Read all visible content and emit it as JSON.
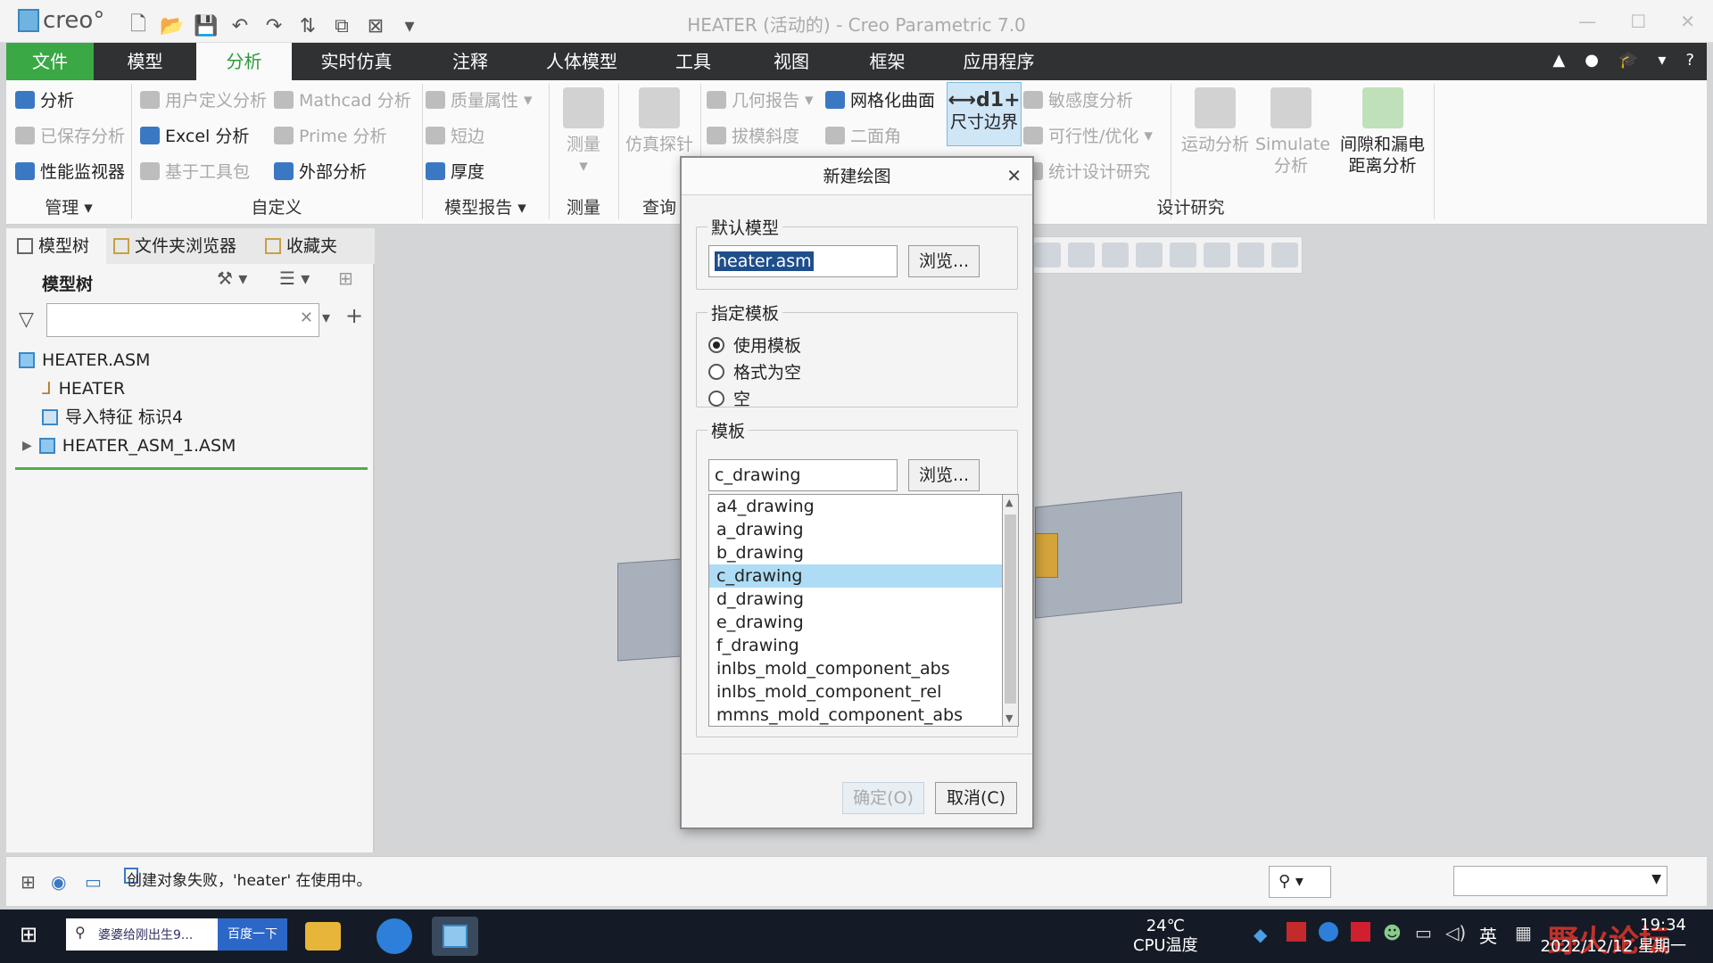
{
  "window": {
    "title": "HEATER (活动的) - Creo Parametric 7.0",
    "logo": "creo°",
    "controls": [
      "—",
      "☐",
      "✕"
    ]
  },
  "ribbon": {
    "tabs": [
      "文件",
      "模型",
      "分析",
      "实时仿真",
      "注释",
      "人体模型",
      "工具",
      "视图",
      "框架",
      "应用程序"
    ],
    "active_tab": "分析",
    "manage": {
      "items": [
        "分析",
        "已保存分析",
        "性能监视器"
      ],
      "group": "管理 ▾"
    },
    "custom": {
      "items": [
        "用户定义分析",
        "Excel 分析",
        "基于工具包",
        "Mathcad 分析",
        "Prime 分析",
        "外部分析"
      ],
      "group": "自定义"
    },
    "report": {
      "items": [
        "质量属性",
        "短边",
        "厚度"
      ],
      "group": "模型报告 ▾"
    },
    "measure": {
      "label": "测量",
      "group": "测量"
    },
    "query": {
      "label": "仿真探针",
      "group": "查询"
    },
    "inspect": {
      "items": [
        "几何报告",
        "拔模斜度",
        "网格化曲面",
        "二面角"
      ],
      "dim": "尺寸边界"
    },
    "design": {
      "items": [
        "敏感度分析",
        "可行性/优化",
        "统计设计研究"
      ],
      "big": [
        "运动分析",
        "Simulate 分析",
        "间隙和漏电 距离分析"
      ],
      "group": "设计研究"
    }
  },
  "left_panel": {
    "tabs": [
      "模型树",
      "文件夹浏览器",
      "收藏夹"
    ],
    "tree_label": "模型树",
    "filter_placeholder": "",
    "tree": [
      "HEATER.ASM",
      "HEATER",
      "导入特征 标识4",
      "HEATER_ASM_1.ASM"
    ]
  },
  "dialog": {
    "title": "新建绘图",
    "default_model_label": "默认模型",
    "default_model_value": "heater.asm",
    "browse": "浏览...",
    "template_spec_label": "指定模板",
    "options": [
      "使用模板",
      "格式为空",
      "空"
    ],
    "selected_option": 0,
    "template_label": "模板",
    "template_value": "c_drawing",
    "templates": [
      "a4_drawing",
      "a_drawing",
      "b_drawing",
      "c_drawing",
      "d_drawing",
      "e_drawing",
      "f_drawing",
      "inlbs_mold_component_abs",
      "inlbs_mold_component_rel",
      "mmns_mold_component_abs"
    ],
    "selected_template": "c_drawing",
    "ok": "确定(O)",
    "cancel": "取消(C)"
  },
  "status": {
    "message": "创建对象失败，'heater' 在使用中。"
  },
  "taskbar": {
    "search_text": "婆婆给刚出生9...",
    "search_button": "百度一下",
    "temp": "24℃",
    "temp_label": "CPU温度",
    "ime": "英",
    "time": "19:34",
    "date": "2022/12/12 星期一",
    "watermark": "野火论坛"
  },
  "colors": {
    "file_tab": "#39a845",
    "active_tab_text": "#2d9a3c",
    "selection": "#aedcf5"
  }
}
